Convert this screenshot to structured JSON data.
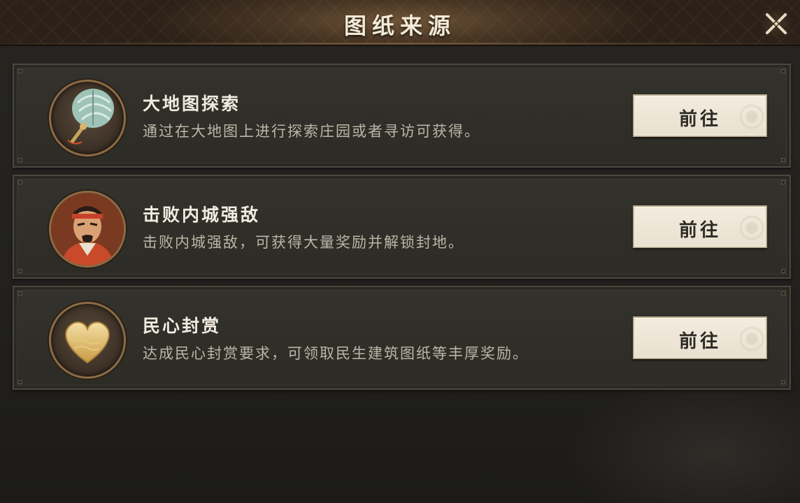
{
  "header": {
    "title": "图纸来源",
    "close_icon": "close-x-icon"
  },
  "colors": {
    "title_text": "#f3ead7",
    "card_bg": "#2d2b26",
    "button_bg": "#ebe3d2",
    "gold_border": "#8c6b45"
  },
  "sources": [
    {
      "icon": "feather-fan-icon",
      "title": "大地图探索",
      "description": "通过在大地图上进行探索庄园或者寻访可获得。",
      "button_label": "前往"
    },
    {
      "icon": "warrior-portrait-icon",
      "title": "击败内城强敌",
      "description": "击败内城强敌，可获得大量奖励并解锁封地。",
      "button_label": "前往"
    },
    {
      "icon": "gold-heart-icon",
      "title": "民心封赏",
      "description": "达成民心封赏要求，可领取民生建筑图纸等丰厚奖励。",
      "button_label": "前往"
    }
  ]
}
